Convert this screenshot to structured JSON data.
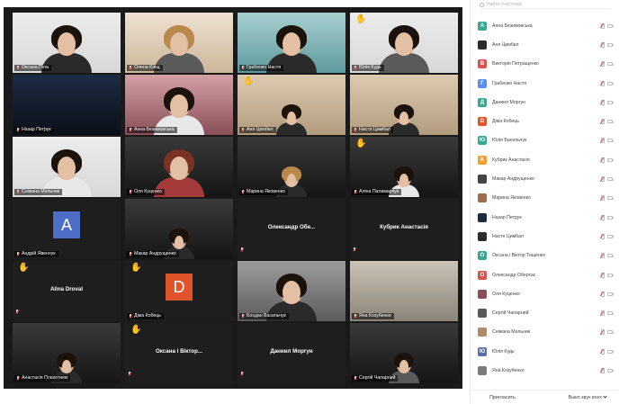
{
  "tiles": [
    {
      "name": "Оксана Піла",
      "style": "v-light",
      "person": {
        "hair": "hair-dark",
        "body": ""
      },
      "speaking": false,
      "hand": false
    },
    {
      "name": "Олена Кліщ",
      "style": "v-warm",
      "person": {
        "hair": "hair-blond",
        "body": "body-grey"
      },
      "speaking": true,
      "hand": false
    },
    {
      "name": "Грабенко Настя",
      "style": "v-teal",
      "person": {
        "hair": "hair-dark",
        "body": ""
      },
      "speaking": false,
      "hand": false
    },
    {
      "name": "Юлія Кудь",
      "style": "v-light",
      "person": {
        "hair": "hair-dark",
        "body": "body-grey"
      },
      "speaking": false,
      "hand": true
    },
    {
      "name": "Назар Петрук",
      "style": "v-night",
      "person": null,
      "speaking": false,
      "hand": false
    },
    {
      "name": "Анна Безимовська",
      "style": "v-rose",
      "person": {
        "hair": "hair-dark",
        "body": "body-white"
      },
      "speaking": false,
      "hand": false
    },
    {
      "name": "Аня Цимбал",
      "style": "v-beige",
      "person": {
        "hair": "hair-dark",
        "body": "",
        "small": true
      },
      "speaking": false,
      "hand": true
    },
    {
      "name": "Настя Цимбал",
      "style": "v-beige",
      "person": {
        "hair": "hair-dark",
        "body": "",
        "small": true
      },
      "speaking": false,
      "hand": false
    },
    {
      "name": "Сніжана Мельник",
      "style": "v-light",
      "person": {
        "hair": "hair-dark",
        "body": "body-white"
      },
      "speaking": false,
      "hand": false
    },
    {
      "name": "Оля Куценко",
      "style": "v-dark",
      "person": {
        "hair": "hair-red",
        "body": "body-red"
      },
      "speaking": false,
      "hand": false
    },
    {
      "name": "Марина Яковенко",
      "style": "v-dark",
      "person": {
        "hair": "hair-blond",
        "body": "",
        "small": true
      },
      "speaking": false,
      "hand": false
    },
    {
      "name": "Аліна Паламарчук",
      "style": "v-dark",
      "person": {
        "hair": "hair-dark",
        "body": "body-white",
        "small": true
      },
      "speaking": false,
      "hand": true
    },
    {
      "name": "Андрій Явенчук",
      "style": "",
      "avatar": "A",
      "avatarClass": "avatar-a",
      "speaking": false,
      "hand": false
    },
    {
      "name": "Макар Андрущенко",
      "style": "v-dark",
      "person": {
        "hair": "hair-dark",
        "body": "",
        "small": true
      },
      "speaking": false,
      "hand": false
    },
    {
      "name": "",
      "center": "Олександр Обе...",
      "speaking": false,
      "hand": false
    },
    {
      "name": "",
      "center": "Кубрик Анастасія",
      "speaking": false,
      "hand": false
    },
    {
      "name": "",
      "center": "Alina Droval",
      "speaking": false,
      "hand": true
    },
    {
      "name": "Діма Кобець",
      "style": "",
      "avatar": "D",
      "avatarClass": "avatar-d",
      "speaking": false,
      "hand": true
    },
    {
      "name": "Бохдан Васильчук",
      "style": "v-grey",
      "person": {
        "hair": "hair-dark",
        "body": ""
      },
      "speaking": false,
      "hand": false
    },
    {
      "name": "Яна Козубенко",
      "style": "v-wall",
      "person": null,
      "speaking": false,
      "hand": false
    },
    {
      "name": "Анастасія Плахотнюк",
      "style": "v-dark",
      "person": {
        "hair": "hair-dark",
        "body": "",
        "small": true
      },
      "speaking": false,
      "hand": false
    },
    {
      "name": "",
      "center": "Оксана і Віктор...",
      "speaking": false,
      "hand": true
    },
    {
      "name": "",
      "center": "Даниил Моргун",
      "speaking": false,
      "hand": false
    },
    {
      "name": "Сергій Чапарний",
      "style": "v-dark",
      "person": {
        "hair": "hair-dark",
        "body": "body-grey",
        "small": true
      },
      "speaking": false,
      "hand": false
    }
  ],
  "panel": {
    "search_placeholder": "Найти участника",
    "participants": [
      {
        "name": "Анна Безимовська",
        "initial": "А",
        "color": "#3aa78f"
      },
      {
        "name": "Аня Цимбал",
        "initial": "",
        "color": "#2b2b2b"
      },
      {
        "name": "Викторія Петращенко",
        "initial": "В",
        "color": "#d9534f"
      },
      {
        "name": "Грабенко Настя",
        "initial": "Г",
        "color": "#5b8def"
      },
      {
        "name": "Даниил Моргун",
        "initial": "Д",
        "color": "#3aa78f"
      },
      {
        "name": "Діма Кобець",
        "initial": "D",
        "color": "#e0532b"
      },
      {
        "name": "Юлія Васильчук",
        "initial": "Ю",
        "color": "#3aa78f"
      },
      {
        "name": "Кубрик Анастасія",
        "initial": "К",
        "color": "#f0a030"
      },
      {
        "name": "Макар Андрущенко",
        "initial": "",
        "color": "#444444"
      },
      {
        "name": "Марина Яковенко",
        "initial": "",
        "color": "#a06a50"
      },
      {
        "name": "Назар Петрук",
        "initial": "",
        "color": "#1d2c45"
      },
      {
        "name": "Настя Цимбал",
        "initial": "",
        "color": "#2b2b2b"
      },
      {
        "name": "Оксана і Віктор Тищенко",
        "initial": "О",
        "color": "#3aa78f"
      },
      {
        "name": "Олександр Обертас",
        "initial": "О",
        "color": "#d9534f"
      },
      {
        "name": "Оля Куценко",
        "initial": "",
        "color": "#8a4f58"
      },
      {
        "name": "Сергій Чапарний",
        "initial": "",
        "color": "#5a5a5a"
      },
      {
        "name": "Сніжана Мельник",
        "initial": "",
        "color": "#b08a6a"
      },
      {
        "name": "Юлія Кудь",
        "initial": "Ю",
        "color": "#5b6ea8"
      },
      {
        "name": "Яна Козубенко",
        "initial": "",
        "color": "#7a7a7a"
      }
    ],
    "invite_label": "Пригласить",
    "mute_all_label": "Выкл звук всех",
    "more_label": "..."
  }
}
